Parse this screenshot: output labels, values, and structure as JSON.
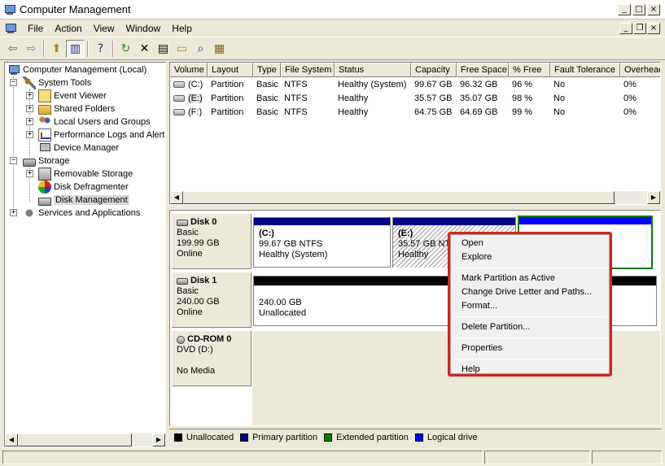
{
  "window": {
    "title": "Computer Management",
    "controls": [
      "_",
      "□",
      "×"
    ]
  },
  "menubar": {
    "items": [
      "File",
      "Action",
      "View",
      "Window",
      "Help"
    ]
  },
  "toolbar": {
    "buttons": [
      "back",
      "forward",
      "up-folder",
      "show-hide-tree",
      "help",
      "refresh",
      "delete",
      "properties",
      "open",
      "search",
      "export"
    ]
  },
  "tree": {
    "root": "Computer Management (Local)",
    "system_tools": "System Tools",
    "event_viewer": "Event Viewer",
    "shared_folders": "Shared Folders",
    "local_users": "Local Users and Groups",
    "perf_logs": "Performance Logs and Alerts",
    "device_manager": "Device Manager",
    "storage": "Storage",
    "removable_storage": "Removable Storage",
    "disk_defrag": "Disk Defragmenter",
    "disk_management": "Disk Management",
    "services": "Services and Applications"
  },
  "volume_table": {
    "columns": [
      "Volume",
      "Layout",
      "Type",
      "File System",
      "Status",
      "Capacity",
      "Free Space",
      "% Free",
      "Fault Tolerance",
      "Overhead"
    ],
    "rows": [
      [
        "(C:)",
        "Partition",
        "Basic",
        "NTFS",
        "Healthy (System)",
        "99.67 GB",
        "96.32 GB",
        "96 %",
        "No",
        "0%"
      ],
      [
        "(E:)",
        "Partition",
        "Basic",
        "NTFS",
        "Healthy",
        "35.57 GB",
        "35.07 GB",
        "98 %",
        "No",
        "0%"
      ],
      [
        "(F:)",
        "Partition",
        "Basic",
        "NTFS",
        "Healthy",
        "64.75 GB",
        "64.69 GB",
        "99 %",
        "No",
        "0%"
      ]
    ]
  },
  "disks": {
    "disk0": {
      "name": "Disk 0",
      "type": "Basic",
      "size": "199.99 GB",
      "state": "Online",
      "part_c_name": "(C:)",
      "part_c_size": "99.67 GB NTFS",
      "part_c_status": "Healthy (System)",
      "part_e_name": "(E:)",
      "part_e_size": "35.57 GB NT",
      "part_e_status": "Healthy"
    },
    "disk1": {
      "name": "Disk 1",
      "type": "Basic",
      "size": "240.00 GB",
      "state": "Online",
      "part_size": "240.00 GB",
      "part_status": "Unallocated"
    },
    "cdrom0": {
      "name": "CD-ROM 0",
      "type": "DVD (D:)",
      "state": "No Media"
    }
  },
  "legend": {
    "unallocated": "Unallocated",
    "primary": "Primary partition",
    "extended": "Extended partition",
    "logical": "Logical drive",
    "colors": {
      "unallocated": "#000000",
      "primary": "#000080",
      "extended": "#008000",
      "logical": "#0000ff"
    }
  },
  "context_menu": {
    "open": "Open",
    "explore": "Explore",
    "mark_active": "Mark Partition as Active",
    "change_letter": "Change Drive Letter and Paths...",
    "format": "Format...",
    "delete": "Delete Partition...",
    "properties": "Properties",
    "help": "Help"
  }
}
